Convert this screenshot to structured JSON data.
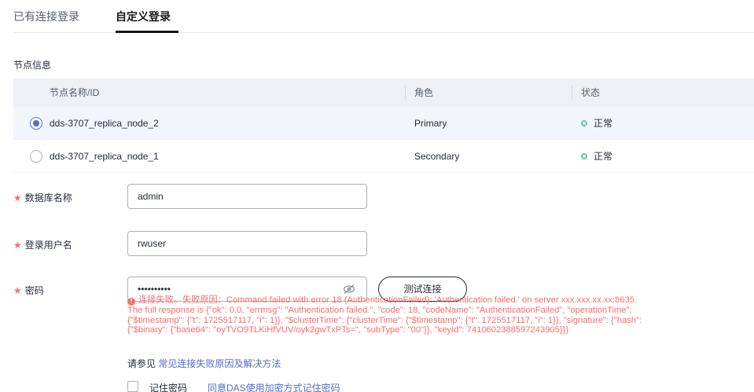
{
  "tabs": [
    {
      "label": "已有连接登录",
      "active": false
    },
    {
      "label": "自定义登录",
      "active": true
    }
  ],
  "node_section": {
    "title": "节点信息",
    "columns": [
      "节点名称/ID",
      "角色",
      "状态"
    ],
    "rows": [
      {
        "name": "dds-3707_replica_node_2",
        "role": "Primary",
        "status": "正常",
        "selected": true
      },
      {
        "name": "dds-3707_replica_node_1",
        "role": "Secondary",
        "status": "正常",
        "selected": false
      }
    ]
  },
  "form": {
    "db_name_label": "数据库名称",
    "db_name_value": "admin",
    "username_label": "登录用户名",
    "username_value": "rwuser",
    "password_label": "密码",
    "password_value": "••••••••••",
    "test_button": "测试连接",
    "required_mark": "★"
  },
  "error": {
    "prefix": "连接失败。失败原因：",
    "line1": "Command failed with error 18 (AuthenticationFailed): 'Authentication failed.' on server xxx.xxx.xx.xx:8635.",
    "line2": "The full response is {\"ok\": 0.0, \"errmsg\": \"Authentication failed.\", \"code\": 18, \"codeName\": \"AuthenticationFailed\", \"operationTime\":",
    "line3": "{\"$timestamp\": {\"t\": 1725517117, \"i\": 1}}, \"$clusterTime\": {\"clusterTime\": {\"$timestamp\": {\"t\": 1725517117, \"i\": 1}}, \"signature\": {\"hash\":",
    "line4": "{\"$binary\": {\"base64\": \"oyTVO9TLKiHfVUV/oyk2gwTxPTs=\", \"subType\": \"00\"}}, \"keyId\": 7410602388597243905}}}"
  },
  "see_also": {
    "text": "请参见",
    "link": "常见连接失败原因及解决方法"
  },
  "remember": {
    "label": "记住密码",
    "link": "同意DAS使用加密方式记住密码",
    "checked": false
  },
  "colors": {
    "accent": "#526ecc",
    "error": "#f66f6a",
    "success": "#50d4ab"
  }
}
